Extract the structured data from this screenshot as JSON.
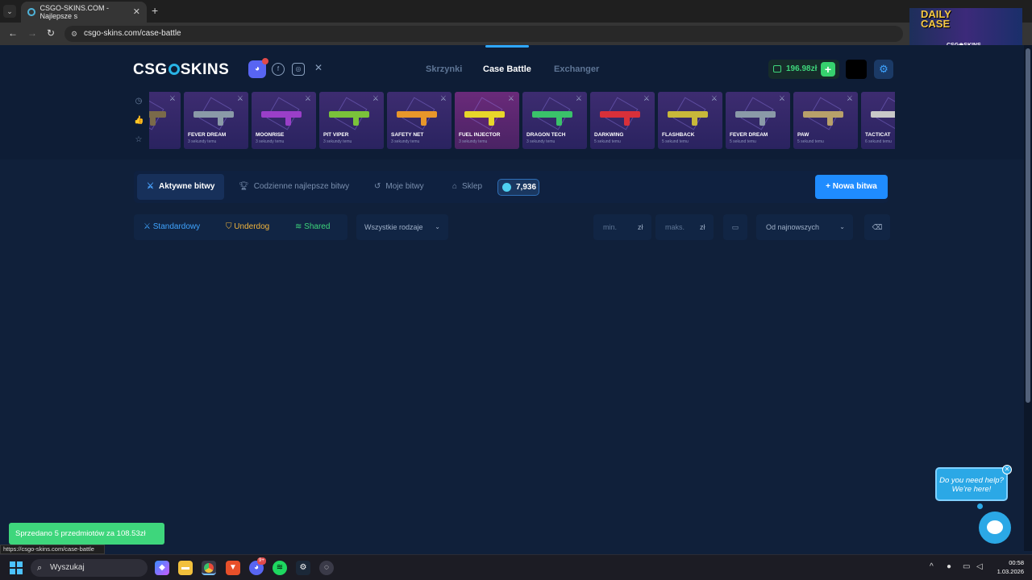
{
  "browser": {
    "tab_title": "CSGO-SKINS.COM - Najlepsze s",
    "url": "csgo-skins.com/case-battle",
    "status_url": "https://csgo-skins.com/case-battle"
  },
  "promo": {
    "line1": "DAILY",
    "line2": "CASE",
    "brand": "CSG◉SKINS"
  },
  "header": {
    "logo_left": "CSG",
    "logo_right": "SKINS",
    "nav": [
      "Skrzynki",
      "Case Battle",
      "Exchanger"
    ],
    "balance": "196.98zł"
  },
  "drops": [
    {
      "name": "E",
      "time": "emu",
      "color": "#7a6a4a"
    },
    {
      "name": "FEVER DREAM",
      "time": "3 sekundy temu",
      "color": "#8a9aa8"
    },
    {
      "name": "MOONRISE",
      "time": "3 sekundy temu",
      "color": "#9a3fc8"
    },
    {
      "name": "PIT VIPER",
      "time": "3 sekundy temu",
      "color": "#7ac23a"
    },
    {
      "name": "SAFETY NET",
      "time": "3 sekundy temu",
      "color": "#e8962a"
    },
    {
      "name": "FUEL INJECTOR",
      "time": "3 sekundy temu",
      "color": "#e8d62a"
    },
    {
      "name": "DRAGON TECH",
      "time": "3 sekundy temu",
      "color": "#3ac26a"
    },
    {
      "name": "DARKWING",
      "time": "5 sekund temu",
      "color": "#d8303a"
    },
    {
      "name": "FLASHBACK",
      "time": "5 sekund temu",
      "color": "#c8b83a"
    },
    {
      "name": "FEVER DREAM",
      "time": "5 sekund temu",
      "color": "#8a9aa8"
    },
    {
      "name": "PAW",
      "time": "5 sekund temu",
      "color": "#b8a06a"
    },
    {
      "name": "TACTICAT",
      "time": "6 sekund temu",
      "color": "#c8c8c8"
    }
  ],
  "battle_tabs": {
    "active": "Aktywne bitwy",
    "daily_best": "Codzienne najlepsze bitwy",
    "mine": "Moje bitwy",
    "shop": "Sklep",
    "coins": "7,936",
    "new_battle": "Nowa bitwa"
  },
  "modes": {
    "standard": "Standardowy",
    "underdog": "Underdog",
    "shared": "Shared"
  },
  "filters": {
    "types": "Wszystkie rodzaje",
    "min_placeholder": "min.",
    "max_placeholder": "maks.",
    "currency": "zł",
    "sort": "Od najnowszych"
  },
  "toast": "Sprzedano 5 przedmiotów za 108.53zł",
  "help": {
    "line1": "Do you need help?",
    "line2": "We're here!"
  },
  "taskbar": {
    "search": "Wyszukaj",
    "time": "00:58",
    "date": "1.03.2026",
    "badge": "9+"
  }
}
